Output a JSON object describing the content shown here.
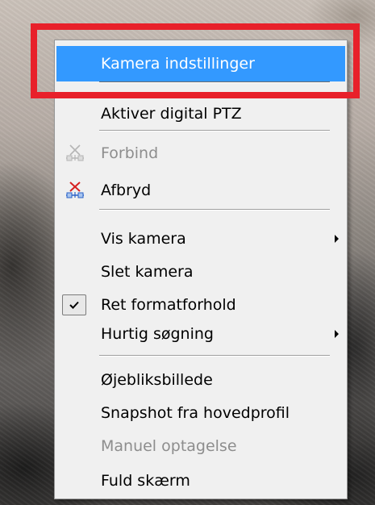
{
  "menu": {
    "items": [
      {
        "id": "camera-settings",
        "label": "Kamera indstillinger",
        "state": "highlighted"
      },
      {
        "id": "enable-digital-ptz",
        "label": "Aktiver digital PTZ",
        "state": "normal"
      },
      {
        "id": "connect",
        "label": "Forbind",
        "state": "disabled",
        "icon": "connect-icon"
      },
      {
        "id": "disconnect",
        "label": "Afbryd",
        "state": "normal",
        "icon": "disconnect-icon"
      },
      {
        "id": "show-camera",
        "label": "Vis kamera",
        "state": "normal",
        "submenu": true
      },
      {
        "id": "delete-camera",
        "label": "Slet kamera",
        "state": "normal"
      },
      {
        "id": "correct-aspect-ratio",
        "label": "Ret formatforhold",
        "state": "normal",
        "checked": true
      },
      {
        "id": "quick-search",
        "label": "Hurtig søgning",
        "state": "normal",
        "submenu": true
      },
      {
        "id": "snapshot",
        "label": "Øjebliksbillede",
        "state": "normal"
      },
      {
        "id": "snapshot-main-profile",
        "label": "Snapshot fra hovedprofil",
        "state": "normal"
      },
      {
        "id": "manual-recording",
        "label": "Manuel optagelse",
        "state": "disabled"
      },
      {
        "id": "full-screen",
        "label": "Fuld skærm",
        "state": "normal"
      }
    ]
  },
  "colors": {
    "highlight": "#3399ff",
    "annotation": "#e8202a",
    "menu_background": "#f0f0f0",
    "disabled_text": "#8d8d8d"
  }
}
